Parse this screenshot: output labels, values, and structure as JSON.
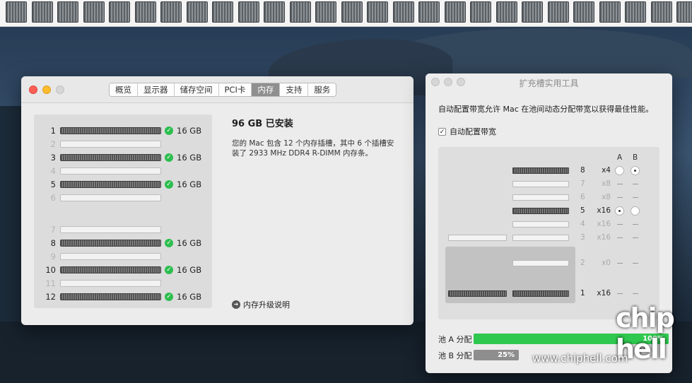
{
  "about_window": {
    "tabs": [
      {
        "label": "概览",
        "active": false
      },
      {
        "label": "显示器",
        "active": false
      },
      {
        "label": "储存空间",
        "active": false
      },
      {
        "label": "PCI卡",
        "active": false
      },
      {
        "label": "内存",
        "active": true
      },
      {
        "label": "支持",
        "active": false
      },
      {
        "label": "服务",
        "active": false
      }
    ],
    "memory": {
      "slots": [
        {
          "num": "1",
          "filled": true,
          "size": "16 GB"
        },
        {
          "num": "2",
          "filled": false,
          "size": ""
        },
        {
          "num": "3",
          "filled": true,
          "size": "16 GB"
        },
        {
          "num": "4",
          "filled": false,
          "size": ""
        },
        {
          "num": "5",
          "filled": true,
          "size": "16 GB"
        },
        {
          "num": "6",
          "filled": false,
          "size": ""
        },
        {
          "num": "7",
          "filled": false,
          "size": ""
        },
        {
          "num": "8",
          "filled": true,
          "size": "16 GB"
        },
        {
          "num": "9",
          "filled": false,
          "size": ""
        },
        {
          "num": "10",
          "filled": true,
          "size": "16 GB"
        },
        {
          "num": "11",
          "filled": false,
          "size": ""
        },
        {
          "num": "12",
          "filled": true,
          "size": "16 GB"
        }
      ],
      "installed": "96 GB 已安装",
      "description": "您的 Mac 包含 12 个内存插槽，其中 6 个插槽安装了 2933 MHz DDR4 R-DIMM 内存条。",
      "upgrade_link": "内存升级说明"
    }
  },
  "expansion_window": {
    "title": "扩充槽实用工具",
    "description": "自动配置带宽允许 Mac 在池间动态分配带宽以获得最佳性能。",
    "auto_config_label": "自动配置带宽",
    "auto_config_checked": true,
    "col_a": "A",
    "col_b": "B",
    "slots": [
      {
        "num": "8",
        "lanes": "x4",
        "filled": true,
        "a": "radio",
        "b": "radio-selected"
      },
      {
        "num": "7",
        "lanes": "x8",
        "filled": false,
        "a": "dash",
        "b": "dash"
      },
      {
        "num": "6",
        "lanes": "x8",
        "filled": false,
        "a": "dash",
        "b": "dash"
      },
      {
        "num": "5",
        "lanes": "x16",
        "filled": true,
        "a": "radio-selected",
        "b": "radio"
      },
      {
        "num": "4",
        "lanes": "x16",
        "filled": false,
        "a": "dash",
        "b": "dash"
      },
      {
        "num": "3",
        "lanes": "x16",
        "filled": false,
        "a": "dash",
        "b": "dash"
      },
      {
        "num": "2",
        "lanes": "x0",
        "filled": false,
        "a": "dash",
        "b": "dash"
      },
      {
        "num": "1",
        "lanes": "x16",
        "filled": true,
        "a": "dash",
        "b": "dash"
      }
    ],
    "pools": [
      {
        "label": "池 A 分配",
        "percent_text": "100%",
        "value": 100,
        "color": "#2fc84f"
      },
      {
        "label": "池 B 分配",
        "percent_text": "25%",
        "value": 25,
        "color": "#8e8e8e"
      }
    ]
  },
  "watermark": {
    "logo": "chip hell",
    "url": "www.chiphell.com"
  }
}
